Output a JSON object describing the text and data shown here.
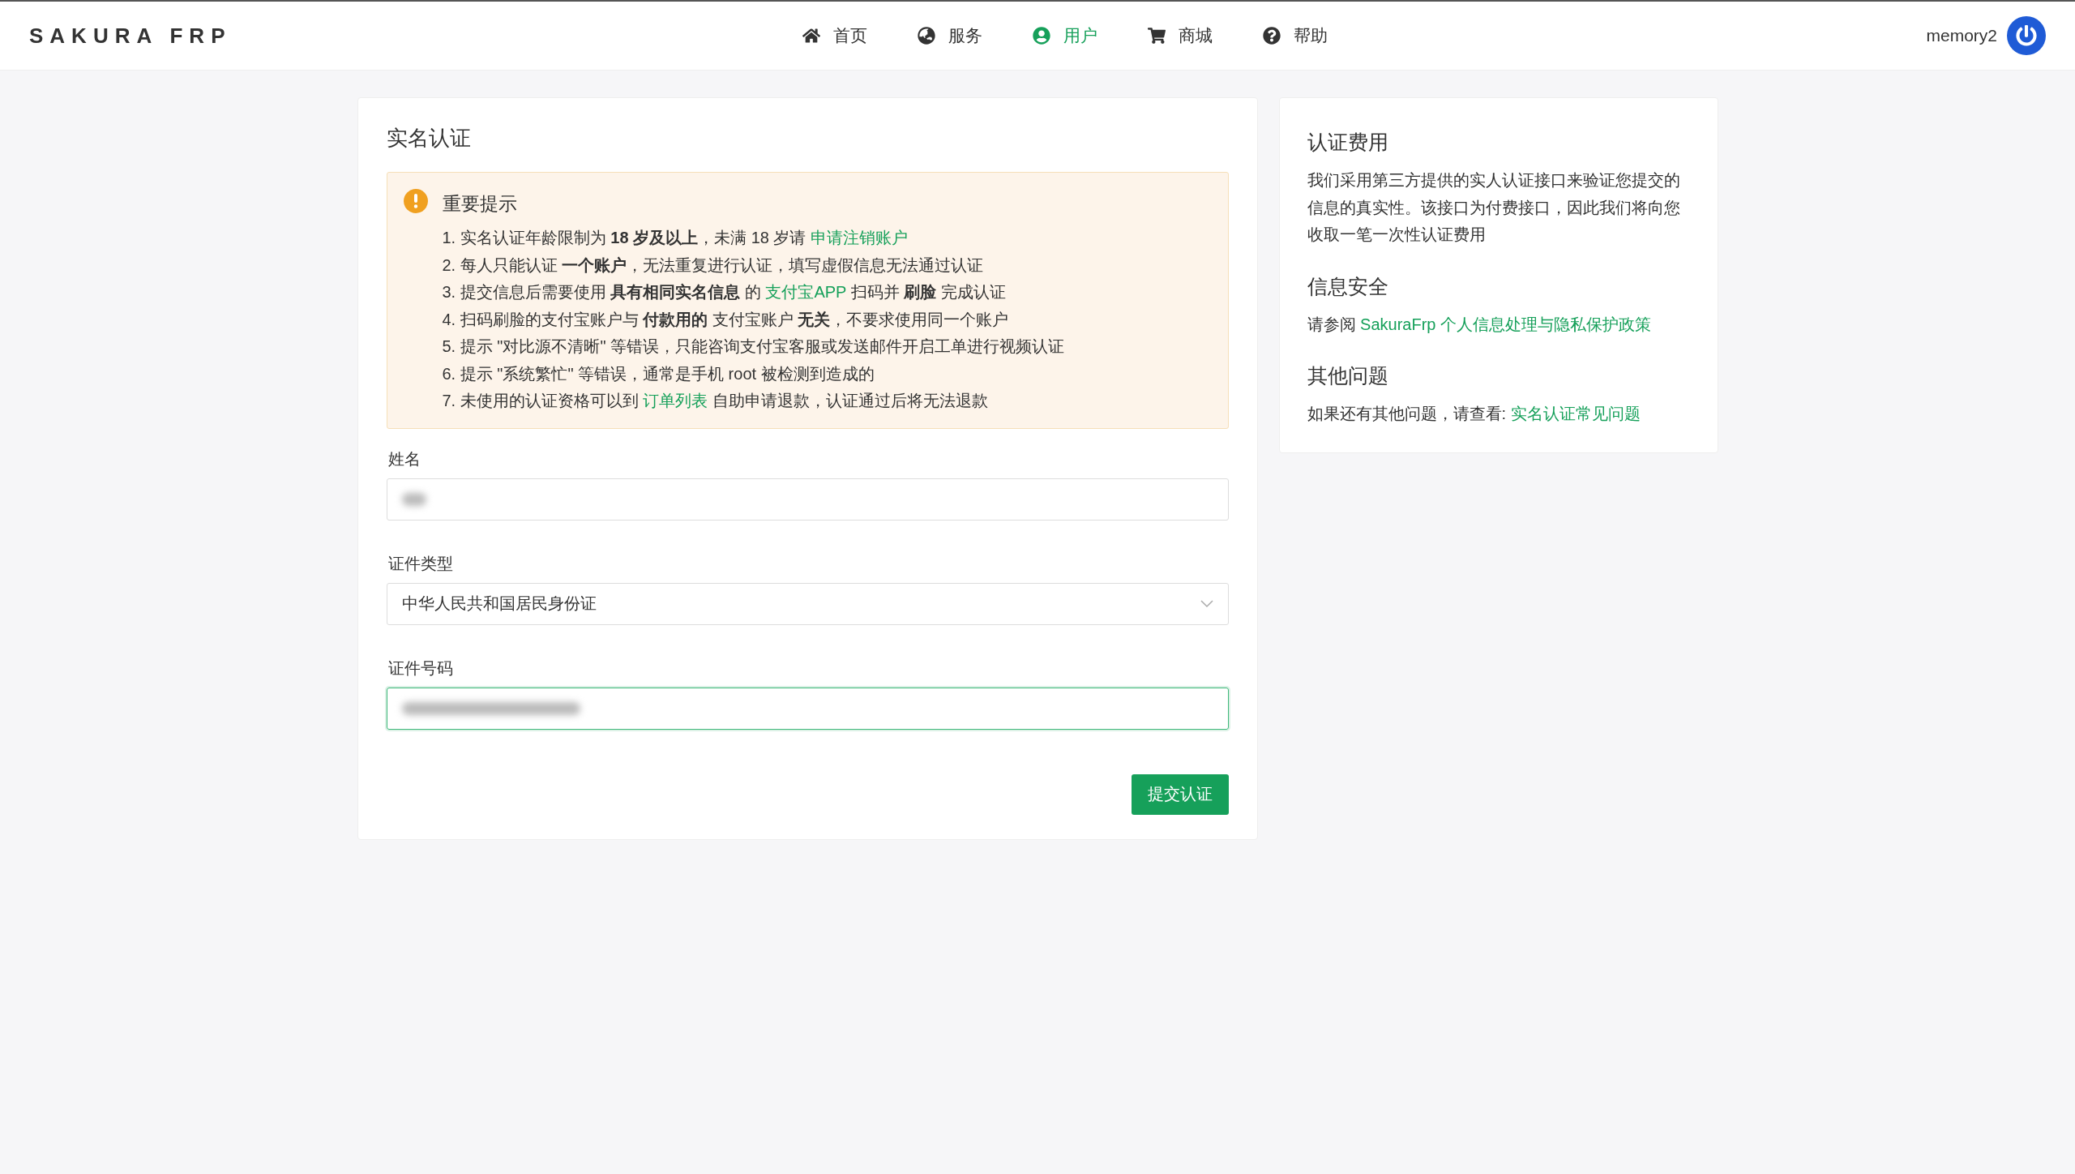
{
  "header": {
    "logo": "SAKURA FRP",
    "nav": [
      {
        "label": "首页",
        "selected": false
      },
      {
        "label": "服务",
        "selected": false
      },
      {
        "label": "用户",
        "selected": true
      },
      {
        "label": "商城",
        "selected": false
      },
      {
        "label": "帮助",
        "selected": false
      }
    ],
    "username": "memory2"
  },
  "main": {
    "title": "实名认证",
    "notice": {
      "title": "重要提示",
      "items": [
        [
          {
            "kind": "text",
            "text": "1. 实名认证年龄限制为 "
          },
          {
            "kind": "bold",
            "text": "18 岁及以上"
          },
          {
            "kind": "text",
            "text": "，未满 18 岁请 "
          },
          {
            "kind": "link",
            "text": "申请注销账户"
          }
        ],
        [
          {
            "kind": "text",
            "text": "2. 每人只能认证 "
          },
          {
            "kind": "bold",
            "text": "一个账户"
          },
          {
            "kind": "text",
            "text": "，无法重复进行认证，填写虚假信息无法通过认证"
          }
        ],
        [
          {
            "kind": "text",
            "text": "3. 提交信息后需要使用 "
          },
          {
            "kind": "bold",
            "text": "具有相同实名信息"
          },
          {
            "kind": "text",
            "text": " 的 "
          },
          {
            "kind": "link",
            "text": "支付宝APP"
          },
          {
            "kind": "text",
            "text": " 扫码并 "
          },
          {
            "kind": "bold",
            "text": "刷脸"
          },
          {
            "kind": "text",
            "text": " 完成认证"
          }
        ],
        [
          {
            "kind": "text",
            "text": "4. 扫码刷脸的支付宝账户与 "
          },
          {
            "kind": "bold",
            "text": "付款用的"
          },
          {
            "kind": "text",
            "text": " 支付宝账户 "
          },
          {
            "kind": "bold",
            "text": "无关"
          },
          {
            "kind": "text",
            "text": "，不要求使用同一个账户"
          }
        ],
        [
          {
            "kind": "text",
            "text": "5. 提示 \"对比源不清晰\" 等错误，只能咨询支付宝客服或发送邮件开启工单进行视频认证"
          }
        ],
        [
          {
            "kind": "text",
            "text": "6. 提示 \"系统繁忙\" 等错误，通常是手机 root 被检测到造成的"
          }
        ],
        [
          {
            "kind": "text",
            "text": "7. 未使用的认证资格可以到 "
          },
          {
            "kind": "link",
            "text": "订单列表"
          },
          {
            "kind": "text",
            "text": " 自助申请退款，认证通过后将无法退款"
          }
        ]
      ]
    },
    "fields": [
      {
        "kind": "input",
        "label": "姓名",
        "focused": false
      },
      {
        "kind": "select",
        "label": "证件类型",
        "value": "中华人民共和国居民身份证",
        "focused": false
      },
      {
        "kind": "input",
        "label": "证件号码",
        "focused": true
      }
    ],
    "submit": "提交认证"
  },
  "side": {
    "sections": [
      {
        "title": "认证费用",
        "body": [
          {
            "kind": "text",
            "text": "我们采用第三方提供的实人认证接口来验证您提交的信息的真实性。该接口为付费接口，因此我们将向您收取一笔一次性认证费用"
          }
        ]
      },
      {
        "title": "信息安全",
        "body": [
          {
            "kind": "text",
            "text": "请参阅 "
          },
          {
            "kind": "link",
            "text": "SakuraFrp 个人信息处理与隐私保护政策"
          }
        ]
      },
      {
        "title": "其他问题",
        "body": [
          {
            "kind": "text",
            "text": "如果还有其他问题，请查看: "
          },
          {
            "kind": "link",
            "text": "实名认证常见问题"
          }
        ]
      }
    ]
  }
}
